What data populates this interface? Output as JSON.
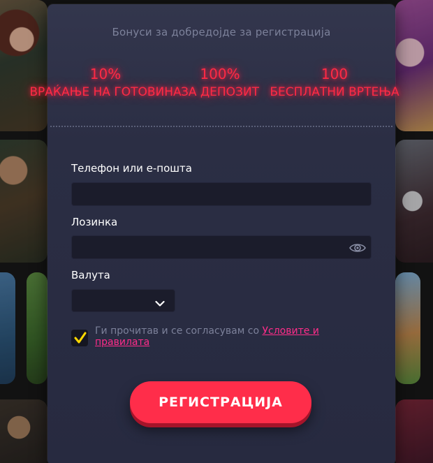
{
  "header": {
    "title": "Бонуси за добредојде за регистрација"
  },
  "bonuses": [
    {
      "value": "10%",
      "label": "ВРАЌАЊЕ НА ГОТОВИНА"
    },
    {
      "value": "100%",
      "label": "ЗА ДЕПОЗИТ"
    },
    {
      "value": "100",
      "label": "БЕСПЛАТНИ ВРТЕЊА"
    }
  ],
  "form": {
    "phone_label": "Телефон или е-пошта",
    "phone_value": "",
    "password_label": "Лозинка",
    "password_value": "",
    "currency_label": "Валута",
    "currency_value": "",
    "agree_text": "Ги прочитав и се согласувам со ",
    "agree_link": "Условите и правилата",
    "agree_checked": true,
    "submit_label": "РЕГИСТРАЦИЈА"
  },
  "colors": {
    "accent": "#ff2d4a",
    "link": "#ff2d8a",
    "check": "#ffd800",
    "panel": "#2b2e44"
  },
  "icons": [
    "eye-icon",
    "chevron-down-icon",
    "checkmark-icon"
  ]
}
